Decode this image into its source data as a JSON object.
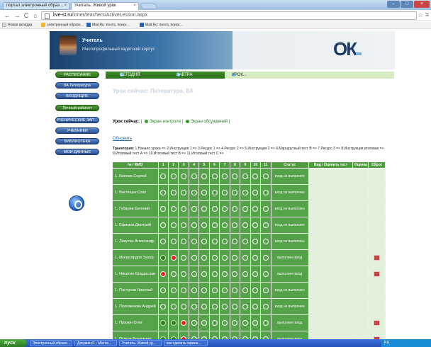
{
  "browser": {
    "tabs": [
      {
        "label": "портал электронный образ…"
      },
      {
        "label": "Учитель. Живой урок"
      }
    ],
    "url_prefix": "live-st.ru",
    "url_rest": "/inner/teachers/ActiveLesson.aspx",
    "bookmarks": [
      "Новая вкладка",
      "электронный образо…",
      "Mail.Ru: почта, поиск…",
      "Mail.Ru: почта, поиск…"
    ]
  },
  "header": {
    "role": "Учитель",
    "org": "Многопрофильный кадетский корпус",
    "logo": "ОК"
  },
  "sidebar": {
    "items": [
      "РАСПИСАНИЕ",
      "8А Литература",
      "ВХОДЯЩИЕ",
      "Личный кабинет",
      "УЧЕНИЧЕСКИЕ ЗАП…",
      "УЧЕБНИКИ",
      "БИБЛИОТЕКА",
      "МОИ ДАННЫЕ"
    ]
  },
  "topnav": {
    "today": "СЕГОДНЯ",
    "tomorrow": "ЗАВТРА",
    "lesson": "УРОК..."
  },
  "lesson_title": "Урок сейчас: Литература, 8А",
  "mode": {
    "label": "Урок сейчас:",
    "control": "Экран контроля",
    "discussion": "Экран обсуждений"
  },
  "refresh": "Обновить",
  "trajectory": {
    "label": "Траектория:",
    "text": "1.Начало урока => 2.Инструкция 1 => 3.Ресурс 1 => 4.Ресурс 2 => 5.Инструкция 2 => 6.Маршрутный тест В => 7.Ресурс 3 => 8.Инструкция итоговая => 9.Итоговый тест А => 10.Итоговый тест В => 11.Итоговый тест С =>"
  },
  "table": {
    "headers": [
      "№ / ФИО",
      "1",
      "2",
      "3",
      "4",
      "5",
      "6",
      "7",
      "8",
      "9",
      "10",
      "11",
      "Статус",
      "Вид / Оценить тест",
      "Оценка",
      "Сброс"
    ],
    "rows": [
      {
        "name": "1. Беляев Сергей",
        "cells": [
          "o",
          "o",
          "o",
          "o",
          "o",
          "o",
          "o",
          "o",
          "o",
          "o",
          "o"
        ],
        "status": "вход не выполнен",
        "reset": false
      },
      {
        "name": "1. Вислоцек Олег",
        "cells": [
          "o",
          "o",
          "o",
          "o",
          "o",
          "o",
          "o",
          "o",
          "o",
          "o",
          "o"
        ],
        "status": "вход не выполнен",
        "reset": false
      },
      {
        "name": "1. Губарев Евгений",
        "cells": [
          "o",
          "o",
          "o",
          "o",
          "o",
          "o",
          "o",
          "o",
          "o",
          "o",
          "o"
        ],
        "status": "вход не выполнен",
        "reset": false
      },
      {
        "name": "1. Ефимов Дмитрий",
        "cells": [
          "o",
          "o",
          "o",
          "o",
          "o",
          "o",
          "o",
          "o",
          "o",
          "o",
          "o"
        ],
        "status": "вход не выполнен",
        "reset": false
      },
      {
        "name": "1. Лазутин Александр",
        "cells": [
          "o",
          "o",
          "o",
          "o",
          "o",
          "o",
          "o",
          "o",
          "o",
          "o",
          "o"
        ],
        "status": "вход не выполнен",
        "reset": false
      },
      {
        "name": "1. Милосердов Захар",
        "cells": [
          "g",
          "r",
          "o",
          "o",
          "o",
          "o",
          "o",
          "o",
          "o",
          "o",
          "o"
        ],
        "status": "выполнен вход",
        "reset": true
      },
      {
        "name": "1. Никитин Владислав",
        "cells": [
          "r",
          "o",
          "o",
          "o",
          "o",
          "o",
          "o",
          "o",
          "o",
          "o",
          "o"
        ],
        "status": "выполнен вход",
        "reset": true
      },
      {
        "name": "1. Пастухов Николай",
        "cells": [
          "o",
          "o",
          "o",
          "o",
          "o",
          "o",
          "o",
          "o",
          "o",
          "o",
          "o"
        ],
        "status": "вход не выполнен",
        "reset": false
      },
      {
        "name": "1. Половинкин Андрей",
        "cells": [
          "o",
          "o",
          "o",
          "o",
          "o",
          "o",
          "o",
          "o",
          "o",
          "o",
          "o"
        ],
        "status": "вход не выполнен",
        "reset": false
      },
      {
        "name": "1. Пряхин Олег",
        "cells": [
          "g",
          "g",
          "r",
          "o",
          "o",
          "o",
          "o",
          "o",
          "o",
          "o",
          "o"
        ],
        "status": "выполнен вход",
        "reset": true
      },
      {
        "name": "1. Пыжов Владимир",
        "cells": [
          "g",
          "g",
          "r",
          "o",
          "o",
          "o",
          "o",
          "o",
          "o",
          "o",
          "o"
        ],
        "status": "выполнен вход",
        "reset": true
      },
      {
        "name": "1. Ракея Алексей",
        "cells": [
          "g",
          "g",
          "g",
          "r",
          "o",
          "o",
          "o",
          "o",
          "o",
          "o",
          "o"
        ],
        "status": "выполнен вход",
        "reset": true
      }
    ]
  },
  "taskbar": {
    "start": "пуск",
    "items": [
      "Электронный образо…",
      "Документ1 - Micros…",
      "Учитель. Живой ур…",
      "как сделать скрина…"
    ],
    "tray": "RU"
  }
}
